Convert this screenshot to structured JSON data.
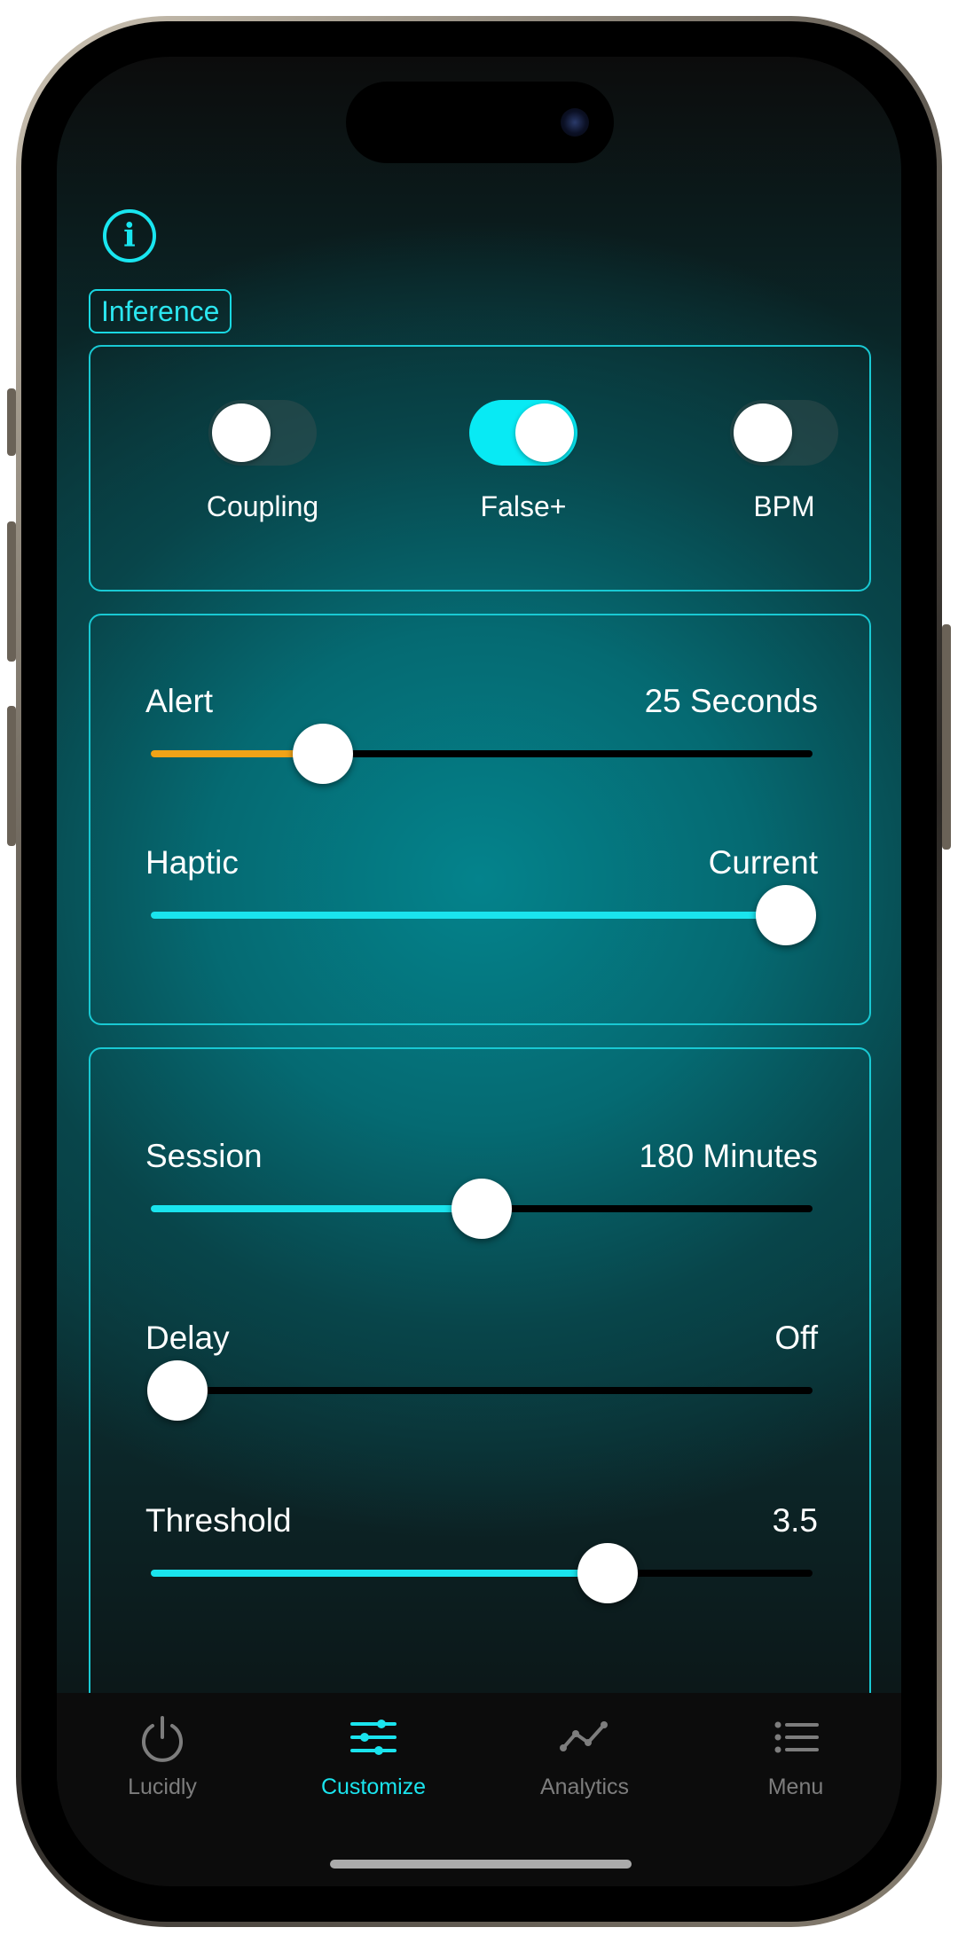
{
  "section_tag": "Inference",
  "toggles": [
    {
      "label": "Coupling",
      "on": false
    },
    {
      "label": "False+",
      "on": true
    },
    {
      "label": "BPM",
      "on": false
    }
  ],
  "sliders": [
    {
      "label": "Alert",
      "value": "25 Seconds",
      "fraction": 0.26,
      "fill_color": "#f0a317"
    },
    {
      "label": "Haptic",
      "value": "Current",
      "fraction": 0.96,
      "fill_color": "#1ae4ee"
    },
    {
      "label": "Session",
      "value": "180 Minutes",
      "fraction": 0.5,
      "fill_color": "#1ae4ee"
    },
    {
      "label": "Delay",
      "value": "Off",
      "fraction": 0.04,
      "fill_color": "#1ae4ee"
    },
    {
      "label": "Threshold",
      "value": "3.5",
      "fraction": 0.69,
      "fill_color": "#1ae4ee"
    }
  ],
  "tabs": [
    {
      "label": "Lucidly",
      "icon": "power-icon",
      "active": false
    },
    {
      "label": "Customize",
      "icon": "sliders-icon",
      "active": true
    },
    {
      "label": "Analytics",
      "icon": "line-graph-icon",
      "active": false
    },
    {
      "label": "Menu",
      "icon": "list-icon",
      "active": false
    }
  ],
  "colors": {
    "accent": "#1ae4ee",
    "alert_fill": "#f0a317",
    "inactive_tab": "#7d7d7d"
  }
}
